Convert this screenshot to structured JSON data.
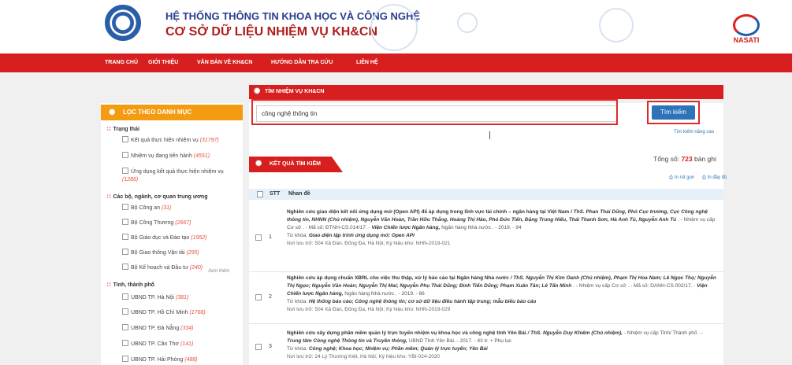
{
  "header": {
    "title1": "HỆ THỐNG THÔNG TIN KHOA HỌC VÀ CÔNG NGHỆ",
    "title2": "CƠ SỞ DỮ LIỆU NHIỆM VỤ KH&CN",
    "nasati": "NASATI"
  },
  "nav": [
    "TRANG CHỦ",
    "GIỚI THIỆU",
    "VĂN BẢN VỀ KH&CN",
    "HƯỚNG DẪN TRA CỨU",
    "LIÊN HỆ"
  ],
  "sidebar": {
    "heading": "LỌC THEO DANH MỤC",
    "groups": [
      {
        "label": "Trạng thái",
        "options": [
          {
            "label": "Kết quả thực hiện nhiệm vụ",
            "count": "(31797)"
          },
          {
            "label": "Nhiệm vụ đang tiến hành",
            "count": "(4551)"
          },
          {
            "label": "Ứng dụng kết quả thực hiện nhiệm vụ",
            "count": "(1286)"
          }
        ]
      },
      {
        "label": "Các bộ, ngành, cơ quan trung ương",
        "options": [
          {
            "label": "Bộ Công an",
            "count": "(31)"
          },
          {
            "label": "Bộ Công Thương",
            "count": "(2667)"
          },
          {
            "label": "Bộ Giáo dục và Đào tạo",
            "count": "(1952)"
          },
          {
            "label": "Bộ Giao thông Vận tải",
            "count": "(295)"
          },
          {
            "label": "Bộ Kế hoạch và Đầu tư",
            "count": "(240)"
          }
        ]
      },
      {
        "label": "Tỉnh, thành phố",
        "options": [
          {
            "label": "UBND TP. Hà Nội",
            "count": "(381)"
          },
          {
            "label": "UBND TP. Hồ Chí Minh",
            "count": "(1768)"
          },
          {
            "label": "UBND TP. Đà Nẵng",
            "count": "(334)"
          },
          {
            "label": "UBND TP. Cần Thơ",
            "count": "(141)"
          },
          {
            "label": "UBND TP. Hải Phòng",
            "count": "(488)"
          }
        ]
      }
    ],
    "more": "Xem thêm"
  },
  "search": {
    "heading": "TÌM NHIỆM VỤ KH&CN",
    "value": "công nghệ thông tin",
    "button": "Tìm kiếm",
    "advanced": "Tìm kiếm nâng cao"
  },
  "results": {
    "heading": "KẾT QUẢ TÌM KIẾM",
    "total_label": "Tổng số:",
    "total": "723",
    "total_unit": "bản ghi",
    "print_short": "In rút gọn",
    "print_full": "In đầy đủ",
    "col_stt": "STT",
    "col_title": "Nhan đề",
    "rows": [
      {
        "num": "1",
        "title": "Nghiên cứu giao diện kết nối ứng dụng mở (Open API) để áp dụng trong lĩnh vực tài chính – ngân hàng tại Việt Nam",
        "authors": "/ ThS. Phan Thái Dũng, Phó Cục trưởng, Cục Công nghệ thông tin, NHNN (Chủ nhiệm), Nguyễn Văn Hoàn, Trần Hữu Thắng, Hoàng Thị Hảo, Phó Đức Tiến, Đặng Trung Hiếu, Thái Thanh Sơn, Hà Anh Tú, Nguyễn Anh Tú",
        "meta": ". - Nhiệm vụ cấp Cơ sở . - Mã số: ĐTNH-CS.014/17. -",
        "org": "Viện Chiến lược Ngân hàng,",
        "meta2": "Ngân hàng Nhà nước . - 2019. - 94",
        "kw_label": "Từ khóa:",
        "keywords": "Giao diện lập trình ứng dụng mở; Open API",
        "storage": "Nơi lưu trữ: 504 Xã Đàn, Đống Đa, Hà Nội; Ký hiệu kho: NHN-2019-021"
      },
      {
        "num": "2",
        "title": "Nghiên cứu áp dụng chuẩn XBRL cho việc thu thập, xử lý báo cáo tại Ngân hàng Nhà nước",
        "authors": "/ ThS. Nguyễn Thị Kim Oanh (Chủ nhiệm), Phạm Thị Hoa Nam; Lê Ngọc Thọ; Nguyễn Thị Ngọc; Nguyễn Văn Hoàn; Nguyễn Thị Mai; Nguyễn Phụ Thái Dũng; Đinh Tiến Dũng; Phạm Xuân Tân; Lê Tấn Minh",
        "meta": ". - Nhiệm vụ cấp Cơ sở . - Mã số: DANH-CS.002/17. -",
        "org": "Viện Chiến lược Ngân hàng,",
        "meta2": "Ngân hàng Nhà nước . - 2019. - 86",
        "kw_label": "Từ khóa:",
        "keywords": "Hệ thống báo cáo; Công nghệ thông tin; cơ sở dữ liệu điều hành tập trung; mẫu biểu báo cáo",
        "storage": "Nơi lưu trữ: 504 Xã Đàn, Đống Đa, Hà Nội; Ký hiệu kho: NHN-2019-029"
      },
      {
        "num": "3",
        "title": "Nghiên cứu xây dựng phần mềm quản lý trực tuyến nhiệm vụ khoa học và công nghệ tỉnh Yên Bái",
        "authors": "/ ThS. Nguyễn Duy Khiêm (Chủ nhiệm),",
        "meta": "- Nhiệm vụ cấp Tỉnh/ Thành phố . -",
        "org": "Trung tâm Công nghệ Thông tin và Truyền thông,",
        "meta2": "UBND Tỉnh Yên Bái. - 2017. - 43 tr. + Phụ lục",
        "kw_label": "Từ khóa:",
        "keywords": "Công nghệ; Khoa học; Nhiệm vụ; Phần mềm; Quản lý trực tuyến; Yên Bái",
        "storage": "Nơi lưu trữ: 24 Lý Thường Kiệt, Hà Nội; Ký hiệu kho: YBI-024-2020"
      }
    ]
  }
}
